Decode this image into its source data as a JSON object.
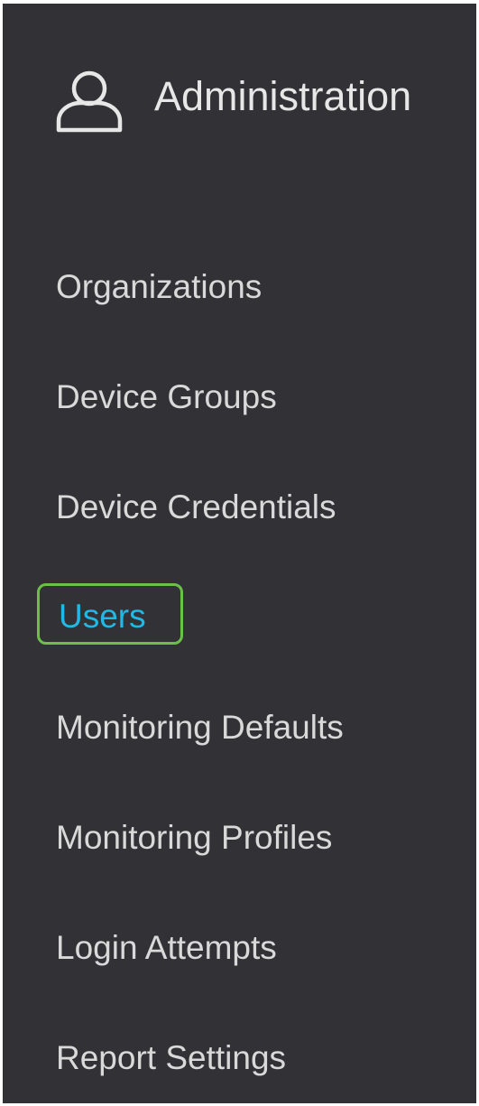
{
  "header": {
    "title": "Administration",
    "icon": "user-icon"
  },
  "menu": {
    "items": [
      {
        "label": "Organizations"
      },
      {
        "label": "Device Groups"
      },
      {
        "label": "Device Credentials"
      },
      {
        "label": "Users",
        "active": true
      },
      {
        "label": "Monitoring Defaults"
      },
      {
        "label": "Monitoring Profiles"
      },
      {
        "label": "Login Attempts"
      },
      {
        "label": "Report Settings"
      }
    ]
  },
  "colors": {
    "background": "#323236",
    "text": "#d9d9d9",
    "active_text": "#22b8e6",
    "active_border": "#6cc04a"
  }
}
